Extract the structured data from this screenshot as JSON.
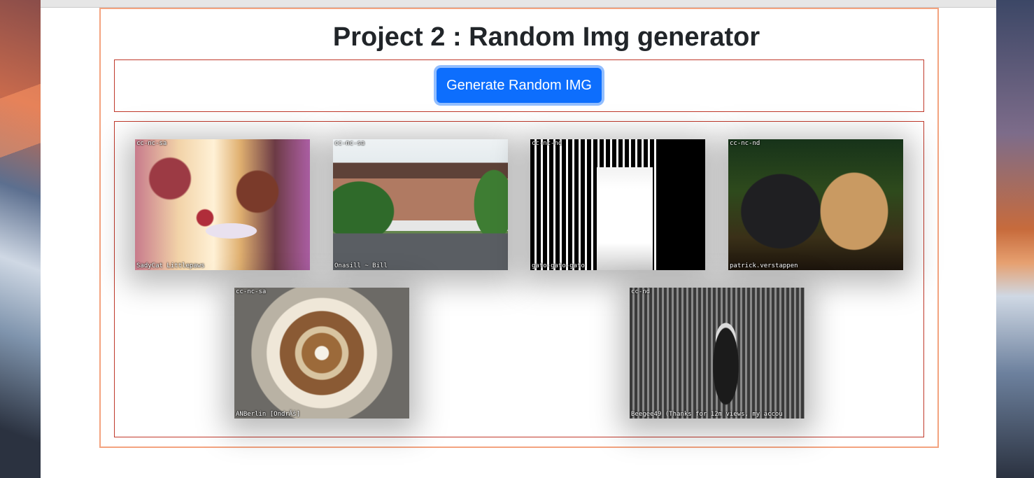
{
  "page": {
    "title": "Project 2 : Random Img generator",
    "generate_button_label": "Generate Random IMG"
  },
  "colors": {
    "button_bg": "#0d6efd",
    "outer_border": "#f3a37f",
    "inner_border": "#c0392b"
  },
  "images": [
    {
      "license": "cc-nc-sa",
      "attribution": "SadyCat Littlepaws"
    },
    {
      "license": "cc-nc-sa",
      "attribution": "Onasill ~ Bill"
    },
    {
      "license": "cc-nc-nd",
      "attribution": "gato-gato-gato"
    },
    {
      "license": "cc-nc-nd",
      "attribution": "patrick.verstappen"
    },
    {
      "license": "cc-nc-sa",
      "attribution": "ANBerlin [OndrĂš]"
    },
    {
      "license": "cc-nd",
      "attribution": "Beegee49 (Thanks for 12m views, my accou"
    }
  ]
}
